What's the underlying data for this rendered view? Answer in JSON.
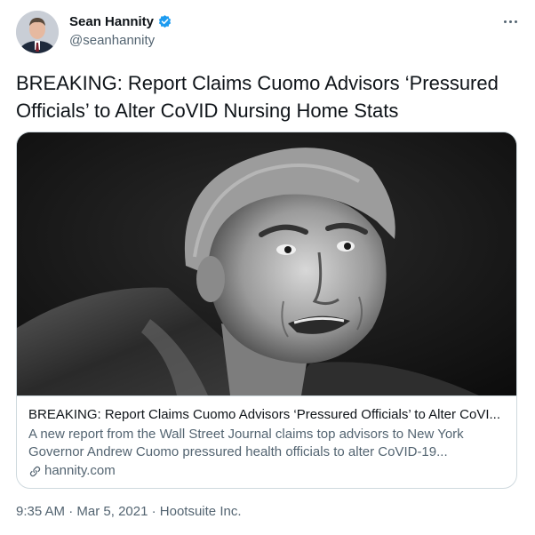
{
  "author": {
    "display_name": "Sean Hannity",
    "handle": "@seanhannity",
    "verified": true,
    "avatar_icon": "avatar-photo"
  },
  "tweet": {
    "text": "BREAKING: Report Claims Cuomo Advisors ‘Pressured Officials’ to Alter CoVID Nursing Home Stats"
  },
  "card": {
    "image_icon": "portrait-photo",
    "title": "BREAKING: Report Claims Cuomo Advisors ‘Pressured Officials’ to Alter CoVI...",
    "description": "A new report from the Wall Street Journal claims top advisors to New York Governor Andrew Cuomo pressured health officials to alter CoVID-19...",
    "domain": "hannity.com",
    "domain_icon": "link-icon"
  },
  "meta": {
    "time": "9:35 AM",
    "date": "Mar 5, 2021",
    "source": "Hootsuite Inc.",
    "separator": " · "
  },
  "colors": {
    "verified_badge": "#1d9bf0",
    "secondary_text": "#536471",
    "primary_text": "#0f1419",
    "border": "#cfd9de"
  }
}
